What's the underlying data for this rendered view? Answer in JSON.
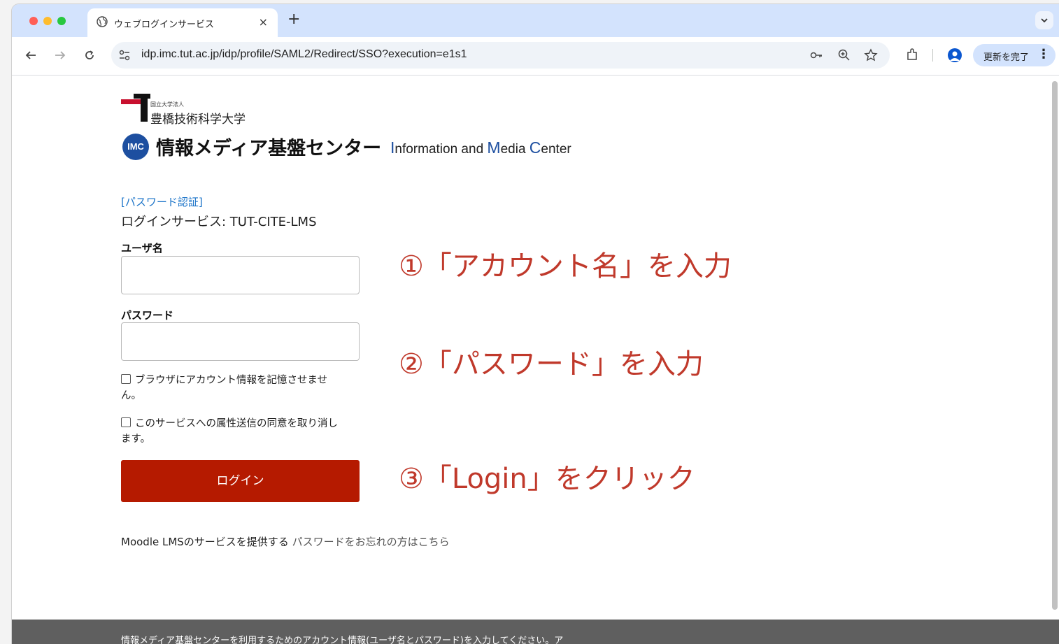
{
  "browser": {
    "tab_title": "ウェブログインサービス",
    "tab_close": "×",
    "new_tab": "+",
    "url": "idp.imc.tut.ac.jp/idp/profile/SAML2/Redirect/SSO?execution=e1s1",
    "update_label": "更新を完了",
    "colors": {
      "tabstrip": "#d3e3fd",
      "close": "#ff5f57",
      "minimize": "#febc2e",
      "maximize": "#28c840"
    }
  },
  "header": {
    "univ_prefix": "国立大学法人",
    "univ_name": "豊橋技術科学大学",
    "imc_badge": "IMC",
    "center_name_jp": "情報メディア基盤センター",
    "center_name_en": {
      "i": "I",
      "i_rest": "nformation and ",
      "m": "M",
      "m_rest": "edia ",
      "c": "C",
      "c_rest": "enter"
    }
  },
  "form": {
    "auth_type": "[パスワード認証]",
    "login_service": "ログインサービス: TUT-CITE-LMS",
    "username_label": "ユーザ名",
    "username_value": "",
    "password_label": "パスワード",
    "password_value": "",
    "remember_label": "ブラウザにアカウント情報を記憶させません。",
    "revoke_consent_label": "このサービスへの属性送信の同意を取り消します。",
    "login_button": "ログイン"
  },
  "annotations": {
    "step1": "①「アカウント名」を入力",
    "step2": "②「パスワード」を入力",
    "step3": "③「Login」をクリック",
    "color": "#c0392b"
  },
  "bottom": {
    "provider_text": "Moodle LMSのサービスを提供する",
    "forgot_link": "パスワードをお忘れの方はこちら"
  },
  "footer": {
    "text": "情報メディア基盤センターを利用するためのアカウント情報(ユーザ名とパスワード)を入力してください。ア"
  }
}
